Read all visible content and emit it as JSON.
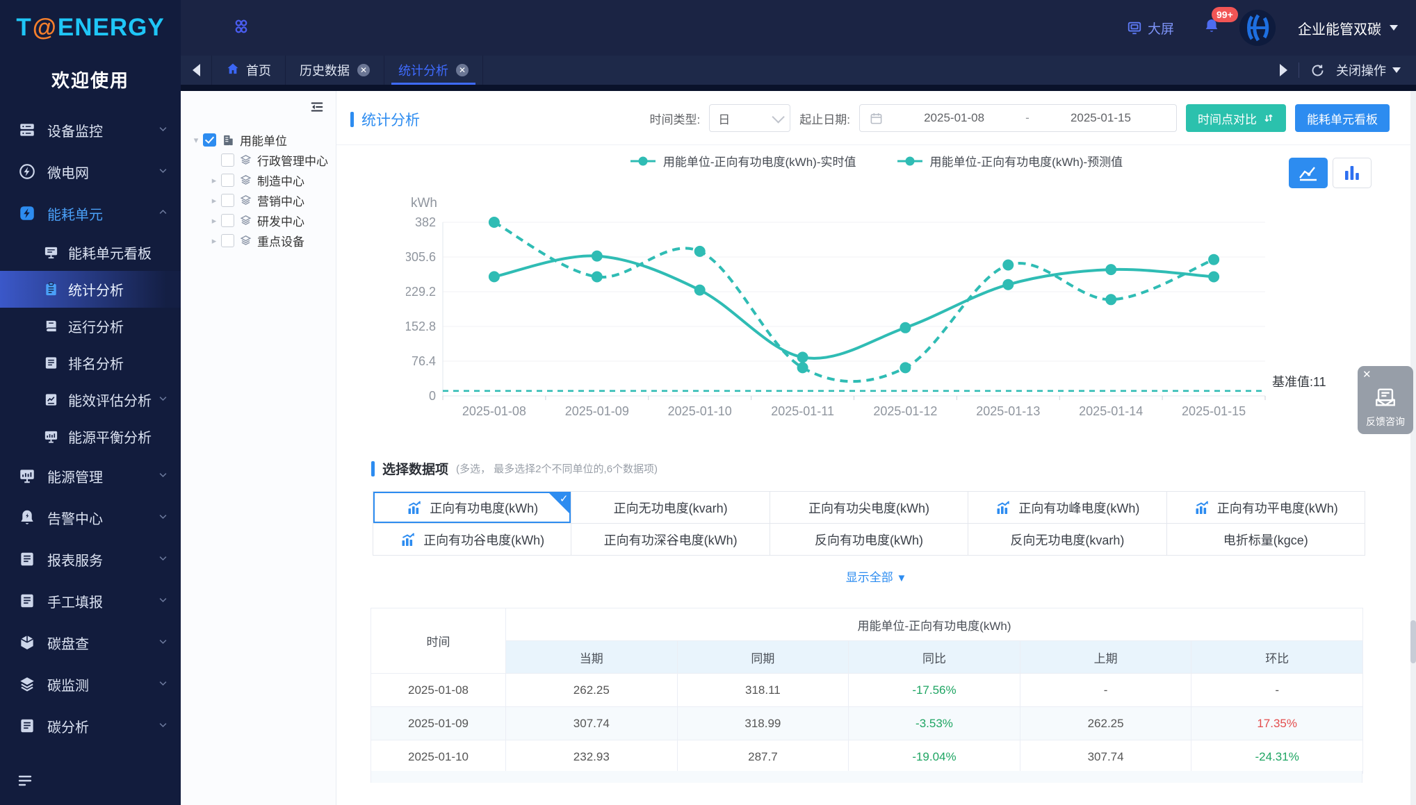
{
  "app": {
    "logo_t": "T",
    "logo_at": "@",
    "logo_rest": "ENERGY",
    "welcome": "欢迎使用"
  },
  "colors": {
    "accent": "#2d8cf0",
    "teal": "#2fbcb4",
    "green": "#1fa563",
    "red": "#e34d4d",
    "sidebar_bg": "#121c3d"
  },
  "topbar": {
    "big_screen": "大屏",
    "badge": "99+",
    "org": "企业能管双碳"
  },
  "tabbar": {
    "tabs": [
      {
        "label": "首页",
        "home": true
      },
      {
        "label": "历史数据",
        "closable": true
      },
      {
        "label": "统计分析",
        "closable": true,
        "active": true
      }
    ],
    "close_ops": "关闭操作"
  },
  "sidebar": {
    "items": [
      {
        "icon": "server-icon",
        "label": "设备监控",
        "chevron": "down"
      },
      {
        "icon": "bolt-circle-icon",
        "label": "微电网",
        "chevron": "down"
      },
      {
        "icon": "bolt-square-icon",
        "label": "能耗单元",
        "chevron": "up",
        "accent": true,
        "children": [
          {
            "icon": "board-icon",
            "label": "能耗单元看板"
          },
          {
            "icon": "clipboard-icon",
            "label": "统计分析",
            "active": true
          },
          {
            "icon": "book-icon",
            "label": "运行分析"
          },
          {
            "icon": "book2-icon",
            "label": "排名分析"
          },
          {
            "icon": "gauge-icon",
            "label": "能效评估分析",
            "chevron": "down"
          },
          {
            "icon": "chart-screen-icon",
            "label": "能源平衡分析"
          }
        ]
      },
      {
        "icon": "chart-screen-icon",
        "label": "能源管理",
        "chevron": "down"
      },
      {
        "icon": "alarm-icon",
        "label": "告警中心",
        "chevron": "down"
      },
      {
        "icon": "book2-icon",
        "label": "报表服务",
        "chevron": "down"
      },
      {
        "icon": "book2-icon",
        "label": "手工填报",
        "chevron": "down"
      },
      {
        "icon": "cube-icon",
        "label": "碳盘查",
        "chevron": "down"
      },
      {
        "icon": "layers3-icon",
        "label": "碳监测",
        "chevron": "down"
      },
      {
        "icon": "book2-icon",
        "label": "碳分析",
        "chevron": "down"
      }
    ]
  },
  "tree": {
    "root": {
      "label": "用能单位",
      "checked": true,
      "expanded": true
    },
    "children": [
      {
        "label": "行政管理中心",
        "leaf": true
      },
      {
        "label": "制造中心"
      },
      {
        "label": "营销中心"
      },
      {
        "label": "研发中心"
      },
      {
        "label": "重点设备"
      }
    ]
  },
  "panel": {
    "title": "统计分析"
  },
  "filters": {
    "time_type_label": "时间类型:",
    "time_type_value": "日",
    "date_label": "起止日期:",
    "date_start": "2025-01-08",
    "date_sep": "-",
    "date_end": "2025-01-15",
    "compare_btn": "时间点对比",
    "board_btn": "能耗单元看板"
  },
  "chart_data": {
    "type": "line",
    "ylabel": "kWh",
    "x": [
      "2025-01-08",
      "2025-01-09",
      "2025-01-10",
      "2025-01-11",
      "2025-01-12",
      "2025-01-13",
      "2025-01-14",
      "2025-01-15"
    ],
    "series": [
      {
        "name": "用能单位-正向有功电度(kWh)-实时值",
        "style": "solid",
        "values": [
          262.25,
          307.74,
          232.93,
          85,
          150,
          245,
          278,
          262
        ]
      },
      {
        "name": "用能单位-正向有功电度(kWh)-预测值",
        "style": "dashed",
        "values": [
          382,
          262,
          318,
          62,
          62,
          288,
          212,
          300
        ]
      }
    ],
    "baseline": {
      "value": 11,
      "label": "基准值:11"
    },
    "yticks": [
      0,
      76.4,
      152.8,
      229.2,
      305.6,
      382
    ],
    "ylim": [
      0,
      382
    ],
    "grid": true,
    "legend_position": "top",
    "color": "#2fbcb4"
  },
  "dataitems": {
    "title": "选择数据项",
    "hint": "(多选， 最多选择2个不同单位的,6个数据项)",
    "show_all": "显示全部",
    "items": [
      {
        "label": "正向有功电度(kWh)",
        "icon": true,
        "selected": true
      },
      {
        "label": "正向无功电度(kvarh)"
      },
      {
        "label": "正向有功尖电度(kWh)"
      },
      {
        "label": "正向有功峰电度(kWh)",
        "icon": true
      },
      {
        "label": "正向有功平电度(kWh)",
        "icon": true
      },
      {
        "label": "正向有功谷电度(kWh)",
        "icon": true
      },
      {
        "label": "正向有功深谷电度(kWh)"
      },
      {
        "label": "反向有功电度(kWh)"
      },
      {
        "label": "反向无功电度(kvarh)"
      },
      {
        "label": "电折标量(kgce)"
      }
    ]
  },
  "table": {
    "time_header": "时间",
    "group_header": "用能单位-正向有功电度(kWh)",
    "sub_headers": [
      "当期",
      "同期",
      "同比",
      "上期",
      "环比"
    ],
    "rows": [
      {
        "cells": [
          "2025-01-08",
          "262.25",
          "318.11",
          "-17.56%",
          "-",
          "-"
        ],
        "colors": [
          null,
          null,
          null,
          "green",
          null,
          null
        ]
      },
      {
        "cells": [
          "2025-01-09",
          "307.74",
          "318.99",
          "-3.53%",
          "262.25",
          "17.35%"
        ],
        "colors": [
          null,
          null,
          null,
          "green",
          null,
          "red"
        ],
        "stripe": true
      },
      {
        "cells": [
          "2025-01-10",
          "232.93",
          "287.7",
          "-19.04%",
          "307.74",
          "-24.31%"
        ],
        "colors": [
          null,
          null,
          null,
          "green",
          null,
          "green"
        ]
      }
    ]
  },
  "feedback": {
    "label": "反馈咨询"
  }
}
